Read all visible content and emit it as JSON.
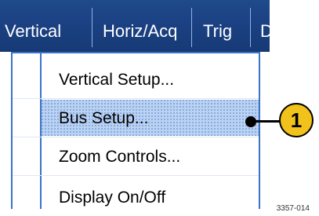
{
  "menubar": {
    "items": [
      {
        "label": "Vertical"
      },
      {
        "label": "Horiz/Acq"
      },
      {
        "label": "Trig"
      },
      {
        "label": "D"
      }
    ]
  },
  "dropdown": {
    "items": [
      {
        "label": "Vertical Setup...",
        "selected": false
      },
      {
        "label": "Bus Setup...",
        "selected": true
      },
      {
        "label": "Zoom Controls...",
        "selected": false
      },
      {
        "label": "Display On/Off",
        "selected": false
      }
    ]
  },
  "callout": {
    "number": "1"
  },
  "figure": {
    "code": "3357-014"
  },
  "colors": {
    "menubar": "#1b4183",
    "border": "#3b73c9",
    "selection": "#bcd2f2",
    "callout_fill": "#f1c21b"
  }
}
